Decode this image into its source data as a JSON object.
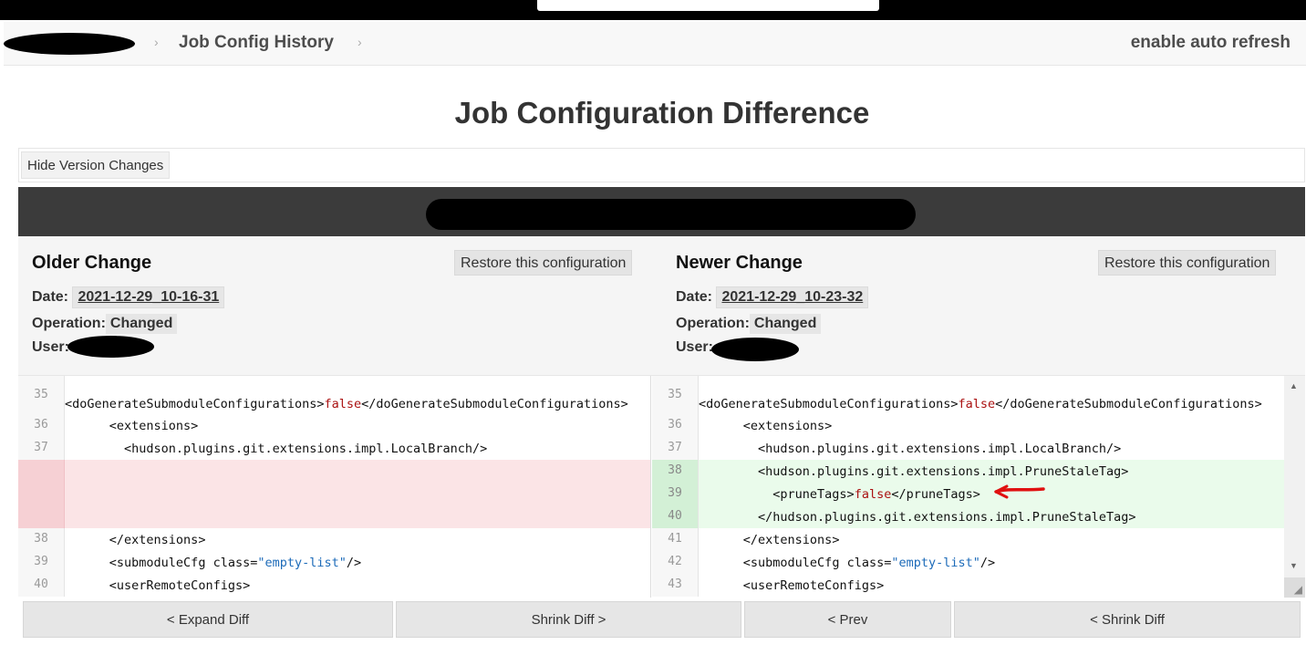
{
  "breadcrumb": {
    "item": "Job Config History",
    "separator": "›",
    "auto_refresh": "enable auto refresh"
  },
  "page_title": "Job Configuration Difference",
  "toggle": {
    "label": "Hide Version Changes"
  },
  "older": {
    "heading": "Older Change",
    "restore_label": "Restore this configuration",
    "date_label": "Date:",
    "date_value": "2021-12-29_10-16-31",
    "operation_label": "Operation:",
    "operation_value": "Changed",
    "user_label": "User:"
  },
  "newer": {
    "heading": "Newer Change",
    "restore_label": "Restore this configuration",
    "date_label": "Date:",
    "date_value": "2021-12-29_10-23-32",
    "operation_label": "Operation:",
    "operation_value": "Changed",
    "user_label": "User:"
  },
  "diff": {
    "left": [
      {
        "num": "35",
        "type": "ctx",
        "indent": 0,
        "parts": [
          [
            "t",
            "<doGenerateSubmoduleConfigurations>"
          ],
          [
            "k",
            "false"
          ],
          [
            "t",
            "</doGenerateSubmoduleConfigurations>"
          ]
        ]
      },
      {
        "num": "36",
        "type": "ctx",
        "indent": 6,
        "parts": [
          [
            "t",
            "<extensions>"
          ]
        ]
      },
      {
        "num": "37",
        "type": "ctx",
        "indent": 8,
        "parts": [
          [
            "t",
            "<hudson.plugins.git.extensions.impl.LocalBranch/>"
          ]
        ]
      },
      {
        "num": "",
        "type": "del",
        "indent": 0,
        "parts": []
      },
      {
        "num": "",
        "type": "del",
        "indent": 0,
        "parts": []
      },
      {
        "num": "",
        "type": "del",
        "indent": 0,
        "parts": []
      },
      {
        "num": "38",
        "type": "ctx",
        "indent": 6,
        "parts": [
          [
            "t",
            "</extensions>"
          ]
        ]
      },
      {
        "num": "39",
        "type": "ctx",
        "indent": 6,
        "parts": [
          [
            "t",
            "<submoduleCfg "
          ],
          [
            "n",
            "class="
          ],
          [
            "a",
            "\"empty-list\""
          ],
          [
            "t",
            "/>"
          ]
        ]
      },
      {
        "num": "40",
        "type": "ctx",
        "indent": 6,
        "parts": [
          [
            "t",
            "<userRemoteConfigs>"
          ]
        ]
      }
    ],
    "right": [
      {
        "num": "35",
        "type": "ctx",
        "indent": 0,
        "parts": [
          [
            "t",
            "<doGenerateSubmoduleConfigurations>"
          ],
          [
            "k",
            "false"
          ],
          [
            "t",
            "</doGenerateSubmoduleConfigurations>"
          ]
        ]
      },
      {
        "num": "36",
        "type": "ctx",
        "indent": 6,
        "parts": [
          [
            "t",
            "<extensions>"
          ]
        ]
      },
      {
        "num": "37",
        "type": "ctx",
        "indent": 8,
        "parts": [
          [
            "t",
            "<hudson.plugins.git.extensions.impl.LocalBranch/>"
          ]
        ]
      },
      {
        "num": "38",
        "type": "add",
        "indent": 8,
        "parts": [
          [
            "t",
            "<hudson.plugins.git.extensions.impl.PruneStaleTag>"
          ]
        ]
      },
      {
        "num": "39",
        "type": "add",
        "indent": 10,
        "parts": [
          [
            "t",
            "<pruneTags>"
          ],
          [
            "k",
            "false"
          ],
          [
            "t",
            "</pruneTags>"
          ]
        ]
      },
      {
        "num": "40",
        "type": "add",
        "indent": 8,
        "parts": [
          [
            "t",
            "</hudson.plugins.git.extensions.impl.PruneStaleTag>"
          ]
        ]
      },
      {
        "num": "41",
        "type": "ctx",
        "indent": 6,
        "parts": [
          [
            "t",
            "</extensions>"
          ]
        ]
      },
      {
        "num": "42",
        "type": "ctx",
        "indent": 6,
        "parts": [
          [
            "t",
            "<submoduleCfg "
          ],
          [
            "n",
            "class="
          ],
          [
            "a",
            "\"empty-list\""
          ],
          [
            "t",
            "/>"
          ]
        ]
      },
      {
        "num": "43",
        "type": "ctx",
        "indent": 6,
        "parts": [
          [
            "t",
            "<userRemoteConfigs>"
          ]
        ]
      }
    ]
  },
  "scroll": {
    "up": "▲",
    "down": "▼",
    "grip": "◢"
  },
  "nav": {
    "expand_diff": "< Expand Diff",
    "shrink_diff_right": "Shrink Diff >",
    "prev": "< Prev",
    "shrink_diff_left": "< Shrink Diff"
  },
  "colors": {
    "deleted_bg": "#fbe4e6",
    "added_bg": "#eafbeb",
    "keyword": "#aa1111",
    "attribute_value": "#1d6bb9",
    "annotation_arrow": "#e01010"
  }
}
